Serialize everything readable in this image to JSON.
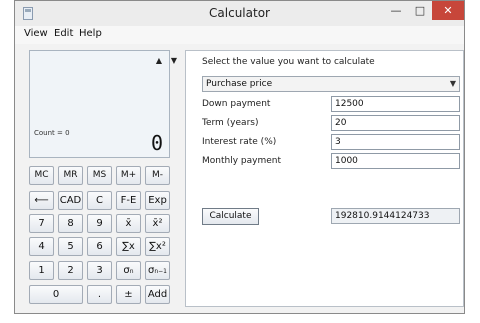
{
  "window": {
    "title": "Calculator",
    "controls": {
      "minimize": "—",
      "maximize": "□",
      "close": "✕"
    }
  },
  "menu": [
    "View",
    "Edit",
    "Help"
  ],
  "display": {
    "memory": "Count = 0",
    "value": "0",
    "scroll_up": "▲",
    "scroll_down": "▼"
  },
  "keypad": {
    "memory_row": [
      "MC",
      "MR",
      "MS",
      "M+",
      "M-"
    ],
    "row2": [
      "⟵",
      "CAD",
      "C",
      "F-E",
      "Exp"
    ],
    "row3": [
      "7",
      "8",
      "9",
      "x̄",
      "x̄²"
    ],
    "row4": [
      "4",
      "5",
      "6",
      "∑x",
      "∑x²"
    ],
    "row5": [
      "1",
      "2",
      "3",
      "σ",
      "σ"
    ],
    "row5_subs": [
      "n",
      "n−1"
    ],
    "row6": [
      "0",
      ".",
      "±",
      "Add"
    ]
  },
  "panel": {
    "title": "Select the value you want to calculate",
    "selection": "Purchase price",
    "fields": [
      {
        "label": "Down payment",
        "value": "12500"
      },
      {
        "label": "Term (years)",
        "value": "20"
      },
      {
        "label": "Interest rate (%)",
        "value": "3"
      },
      {
        "label": "Monthly payment",
        "value": "1000"
      }
    ],
    "calculate_label": "Calculate",
    "result": "192810.9144124733"
  }
}
